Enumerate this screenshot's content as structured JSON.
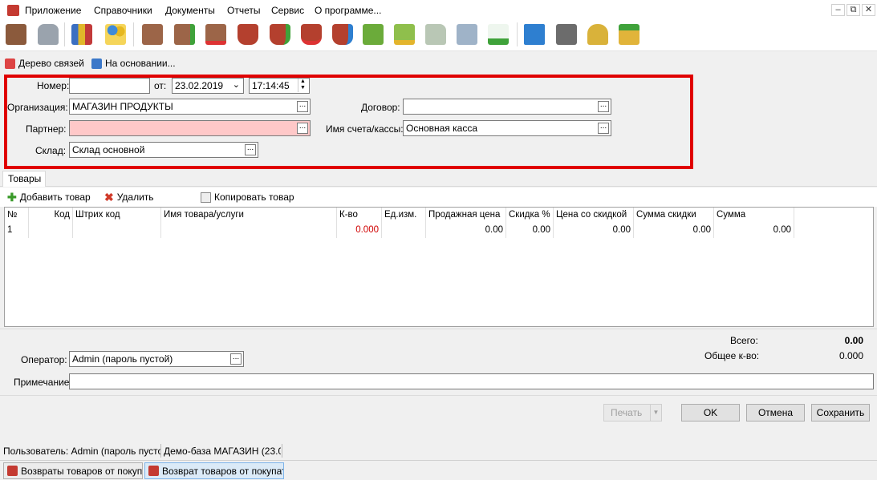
{
  "menu": {
    "items": [
      "Приложение",
      "Справочники",
      "Документы",
      "Отчеты",
      "Сервис",
      "О программе..."
    ],
    "window_controls": [
      "–",
      "⧉",
      "✕"
    ]
  },
  "toolbar": {
    "icons": [
      "exit-icon",
      "lock-icon",
      "books-icon",
      "users-icon",
      "doc-new-icon",
      "doc-add-icon",
      "doc-remove-icon",
      "basket-star-icon",
      "basket-add-icon",
      "basket-remove-icon",
      "basket-move-icon",
      "money-icon",
      "cash-icon",
      "truck-icon",
      "calculator-icon",
      "spellcheck-icon",
      "export-icon",
      "printer-icon",
      "scales-icon",
      "upload-icon"
    ]
  },
  "links": {
    "tree": "Дерево связей",
    "based_on": "На основании..."
  },
  "form": {
    "number_label": "Номер:",
    "number_value": "",
    "from_label": "от:",
    "date_value": "23.02.2019",
    "time_value": "17:14:45",
    "org_label": "Организация:",
    "org_value": "МАГАЗИН ПРОДУКТЫ",
    "contract_label": "Договор:",
    "contract_value": "",
    "partner_label": "Партнер:",
    "partner_value": "",
    "account_label": "Имя счета/кассы:",
    "account_value": "Основная касса",
    "warehouse_label": "Склад:",
    "warehouse_value": "Склад основной",
    "dots": "..."
  },
  "tabs": {
    "goods": "Товары"
  },
  "grid_toolbar": {
    "add": "Добавить товар",
    "delete": "Удалить",
    "copy": "Копировать товар"
  },
  "grid": {
    "columns": [
      "№",
      "Код",
      "Штрих код",
      "Имя товара/услуги",
      "К-во",
      "Ед.изм.",
      "Продажная цена",
      "Скидка %",
      "Цена со скидкой",
      "Сумма скидки",
      "Сумма"
    ],
    "rows": [
      {
        "num": "1",
        "code": "",
        "barcode": "",
        "name": "",
        "qty": "0.000",
        "unit": "",
        "price": "0.00",
        "discount": "0.00",
        "price_discount": "0.00",
        "sum_discount": "0.00",
        "sum": "0.00"
      }
    ]
  },
  "totals": {
    "total_label": "Всего:",
    "total_value": "0.00",
    "qty_label": "Общее к-во:",
    "qty_value": "0.000"
  },
  "operator": {
    "label": "Оператор:",
    "value": "Admin (пароль пустой)"
  },
  "note": {
    "label": "Примечание:",
    "value": ""
  },
  "buttons": {
    "print": "Печать",
    "ok": "OK",
    "cancel": "Отмена",
    "save": "Сохранить"
  },
  "status": {
    "user": "Пользователь: Admin (пароль пусто",
    "db": "Демо-база МАГАЗИН (23.0"
  },
  "taskbar": {
    "task1": "Возвраты товаров от покупате",
    "task2": "Возврат товаров от покупате"
  },
  "colors": {
    "highlight": "#e00000",
    "partner_bg": "#ffc8c8",
    "qty_red": "#d00000"
  }
}
